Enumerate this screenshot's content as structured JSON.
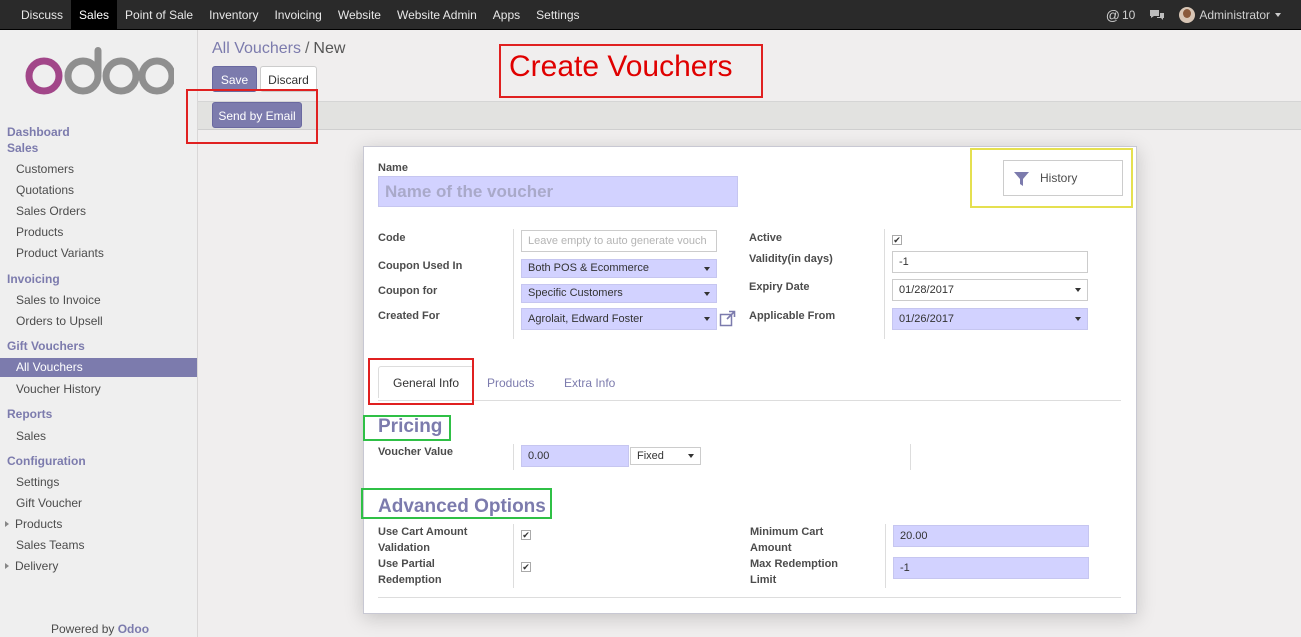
{
  "topbar": {
    "menu": [
      "Discuss",
      "Sales",
      "Point of Sale",
      "Inventory",
      "Invoicing",
      "Website",
      "Website Admin",
      "Apps",
      "Settings"
    ],
    "active_index": 1,
    "notifications_count": "10",
    "user_name": "Administrator"
  },
  "sidebar": {
    "sections": {
      "dashboard": "Dashboard",
      "sales": "Sales",
      "invoicing": "Invoicing",
      "gift_vouchers": "Gift Vouchers",
      "reports": "Reports",
      "configuration": "Configuration"
    },
    "items": {
      "customers": "Customers",
      "quotations": "Quotations",
      "sales_orders": "Sales Orders",
      "products": "Products",
      "product_variants": "Product Variants",
      "sales_to_invoice": "Sales to Invoice",
      "orders_to_upsell": "Orders to Upsell",
      "all_vouchers": "All Vouchers",
      "voucher_history": "Voucher History",
      "reports_sales": "Sales",
      "settings": "Settings",
      "gift_voucher": "Gift Voucher",
      "config_products": "Products",
      "sales_teams": "Sales Teams",
      "delivery": "Delivery"
    },
    "powered_by": "Powered by",
    "powered_brand": "Odoo"
  },
  "breadcrumb": {
    "parent": "All Vouchers",
    "separator": "/",
    "current": "New"
  },
  "buttons": {
    "save": "Save",
    "discard": "Discard",
    "send_by_email": "Send by Email",
    "history": "History"
  },
  "annotation": {
    "title": "Create Vouchers"
  },
  "form": {
    "name_label": "Name",
    "name_placeholder": "Name of the voucher",
    "code_label": "Code",
    "code_placeholder": "Leave empty to auto generate vouch",
    "coupon_used_in_label": "Coupon Used In",
    "coupon_used_in_value": "Both POS & Ecommerce",
    "coupon_for_label": "Coupon for",
    "coupon_for_value": "Specific Customers",
    "created_for_label": "Created For",
    "created_for_value": "Agrolait, Edward Foster",
    "active_label": "Active",
    "active_checked": true,
    "validity_label": "Validity(in days)",
    "validity_value": "-1",
    "expiry_label": "Expiry Date",
    "expiry_value": "01/28/2017",
    "applicable_from_label": "Applicable From",
    "applicable_from_value": "01/26/2017",
    "tabs": [
      "General Info",
      "Products",
      "Extra Info"
    ],
    "pricing_title": "Pricing",
    "voucher_value_label": "Voucher Value",
    "voucher_value": "0.00",
    "voucher_type": "Fixed",
    "advanced_title": "Advanced Options",
    "cart_validation_label_1": "Use Cart Amount",
    "cart_validation_label_2": "Validation",
    "partial_label_1": "Use Partial",
    "partial_label_2": "Redemption",
    "min_cart_label_1": "Minimum Cart",
    "min_cart_label_2": "Amount",
    "min_cart_value": "20.00",
    "max_redemption_label_1": "Max Redemption",
    "max_redemption_label_2": "Limit",
    "max_redemption_value": "-1"
  },
  "colors": {
    "brand": "#7c7bad",
    "required_field": "#d2d2ff",
    "annotation_red": "#e02020",
    "annotation_green": "#2fc046",
    "annotation_yellow": "#e5e050"
  }
}
